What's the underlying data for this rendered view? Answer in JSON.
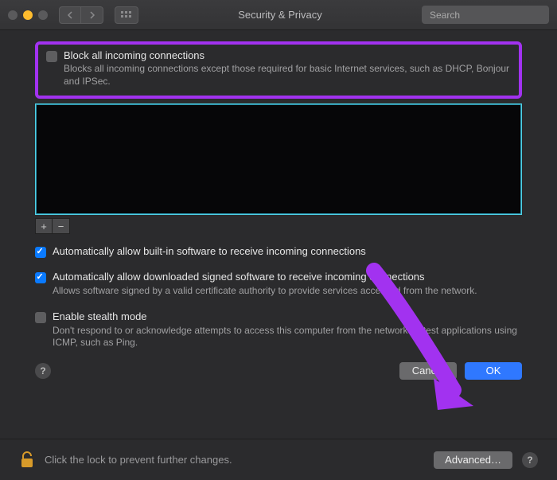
{
  "header": {
    "title": "Security & Privacy",
    "search_placeholder": "Search"
  },
  "options": {
    "block_all": {
      "label": "Block all incoming connections",
      "desc": "Blocks all incoming connections except those required for basic Internet services, such as DHCP, Bonjour and IPSec."
    },
    "auto_builtin": {
      "label": "Automatically allow built-in software to receive incoming connections"
    },
    "auto_signed": {
      "label": "Automatically allow downloaded signed software to receive incoming connections",
      "desc": "Allows software signed by a valid certificate authority to provide services accessed from the network."
    },
    "stealth": {
      "label": "Enable stealth mode",
      "desc": "Don't respond to or acknowledge attempts to access this computer from the network by test applications using ICMP, such as Ping."
    }
  },
  "buttons": {
    "cancel": "Cancel",
    "ok": "OK",
    "advanced": "Advanced…",
    "plus": "+",
    "minus": "−",
    "help": "?"
  },
  "footer": {
    "lock_text": "Click the lock to prevent further changes."
  }
}
